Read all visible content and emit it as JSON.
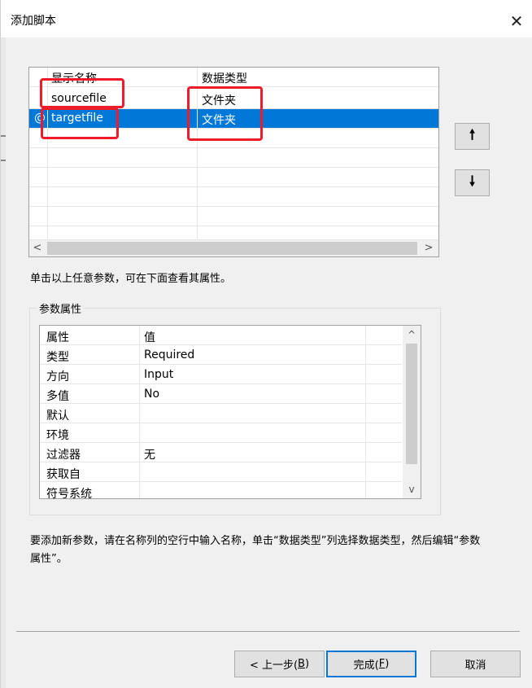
{
  "window": {
    "title": "添加脚本",
    "close_glyph": "✕"
  },
  "params_table": {
    "headers": {
      "name": "显示名称",
      "type": "数据类型"
    },
    "rows": [
      {
        "indicator": "",
        "name": "sourcefile",
        "type": "文件夹",
        "selected": false
      },
      {
        "indicator": "@",
        "name": "targetfile",
        "type": "文件夹",
        "selected": true
      }
    ],
    "scroll_left": "<",
    "scroll_right": ">"
  },
  "move_up_glyph": "🠕",
  "move_down_glyph": "🠗",
  "hint": "单击以上任意参数，可在下面查看其属性。",
  "props_group": {
    "label": "参数属性",
    "headers": {
      "name": "属性",
      "value": "值"
    },
    "rows": [
      {
        "name": "类型",
        "value": "Required"
      },
      {
        "name": "方向",
        "value": "Input"
      },
      {
        "name": "多值",
        "value": "No"
      },
      {
        "name": "默认",
        "value": ""
      },
      {
        "name": "环境",
        "value": ""
      },
      {
        "name": "过滤器",
        "value": "无"
      },
      {
        "name": "获取自",
        "value": ""
      },
      {
        "name": "符号系统",
        "value": ""
      }
    ],
    "scroll_up": "^",
    "scroll_down": "v"
  },
  "note": "要添加新参数，请在名称列的空行中输入名称，单击“数据类型”列选择数据类型，然后编辑“参数属性”。",
  "buttons": {
    "back": {
      "text": "< 上一步(",
      "key": "B",
      "end": ")"
    },
    "finish": {
      "text": "完成(",
      "key": "F",
      "end": ")"
    },
    "cancel": "取消"
  },
  "highlight_color": "#ee1b2b",
  "selection_color": "#0078d7"
}
